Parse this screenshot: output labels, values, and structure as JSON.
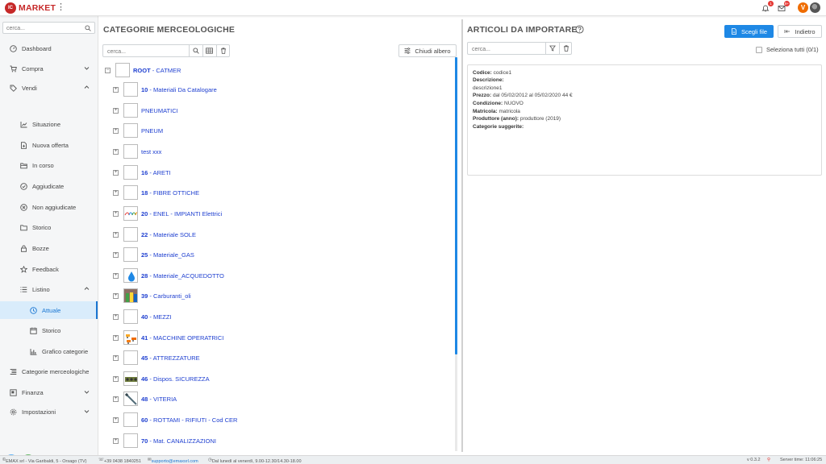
{
  "app": {
    "logo_initials": "IC",
    "logo_text": "MARKET",
    "brand_letter": "V"
  },
  "topbar": {
    "notifications_count": "1",
    "messages_count": "9+"
  },
  "sidebar": {
    "search_placeholder": "cerca...",
    "items": [
      {
        "label": "Dashboard",
        "icon": "dashboard-icon"
      },
      {
        "label": "Compra",
        "icon": "cart-icon",
        "chevron": "down"
      },
      {
        "label": "Vendi",
        "icon": "tag-icon",
        "chevron": "up"
      },
      {
        "label": "Situazione",
        "icon": "chart-line-icon"
      },
      {
        "label": "Nuova offerta",
        "icon": "new-document-icon"
      },
      {
        "label": "In corso",
        "icon": "folder-open-icon"
      },
      {
        "label": "Aggiudicate",
        "icon": "check-circle-icon"
      },
      {
        "label": "Non aggiudicate",
        "icon": "x-circle-icon"
      },
      {
        "label": "Storico",
        "icon": "folder-icon"
      },
      {
        "label": "Bozze",
        "icon": "lock-icon"
      },
      {
        "label": "Feedback",
        "icon": "star-icon"
      },
      {
        "label": "Listino",
        "icon": "list-icon",
        "chevron": "up"
      },
      {
        "label": "Attuale",
        "icon": "clock-icon",
        "active": true
      },
      {
        "label": "Storico",
        "icon": "calendar-icon"
      },
      {
        "label": "Grafico categorie",
        "icon": "bar-chart-icon"
      },
      {
        "label": "Categorie merceologiche",
        "icon": "tree-list-icon"
      },
      {
        "label": "Finanza",
        "icon": "finance-icon",
        "chevron": "down"
      },
      {
        "label": "Impostazioni",
        "icon": "gear-icon",
        "chevron": "down"
      }
    ]
  },
  "categories": {
    "title": "CATEGORIE MERCEOLOGICHE",
    "search_placeholder": "cerca...",
    "collapse_label": "Chiudi albero",
    "root": {
      "code": "ROOT",
      "name": "CATMER"
    },
    "rows": [
      {
        "code": "10",
        "name": "Materiali Da Catalogare",
        "thumb": "blank"
      },
      {
        "code": "",
        "name": "PNEUMATICI",
        "thumb": "blank"
      },
      {
        "code": "",
        "name": "PNEUM",
        "thumb": "blank"
      },
      {
        "code": "",
        "name": "test xxx",
        "thumb": "blank"
      },
      {
        "code": "16",
        "name": "ARETI",
        "thumb": "blank"
      },
      {
        "code": "18",
        "name": "FIBRE OTTICHE",
        "thumb": "blank"
      },
      {
        "code": "20",
        "name": "ENEL - IMPIANTI Elettrici",
        "thumb": "enel"
      },
      {
        "code": "22",
        "name": "Materiale SOLE",
        "thumb": "blank"
      },
      {
        "code": "25",
        "name": "Materiale_GAS",
        "thumb": "blank"
      },
      {
        "code": "28",
        "name": "Materiale_ACQUEDOTTO",
        "thumb": "water"
      },
      {
        "code": "39",
        "name": "Carburanti_oli",
        "thumb": "fuel"
      },
      {
        "code": "40",
        "name": "MEZZI",
        "thumb": "blank"
      },
      {
        "code": "41",
        "name": "MACCHINE OPERATRICI",
        "thumb": "machines"
      },
      {
        "code": "45",
        "name": "ATTREZZATURE",
        "thumb": "blank"
      },
      {
        "code": "46",
        "name": "Dispos. SICUREZZA",
        "thumb": "safety"
      },
      {
        "code": "48",
        "name": "VITERIA",
        "thumb": "screw"
      },
      {
        "code": "60",
        "name": "ROTTAMI - RIFIUTI - Cod CER",
        "thumb": "blank"
      },
      {
        "code": "70",
        "name": "Mat. CANALIZZAZIONI",
        "thumb": "blank"
      }
    ]
  },
  "import": {
    "title": "ARTICOLI DA IMPORTARE",
    "choose_file_label": "Scegli file",
    "back_label": "Indietro",
    "search_placeholder": "cerca...",
    "select_all_label": "Seleziona tutti (0/1)",
    "item": {
      "codice_label": "Codice:",
      "codice_value": "codice1",
      "descrizione_label": "Descrizione:",
      "descrizione_value": "descrizione1",
      "prezzo_label": "Prezzo:",
      "prezzo_value": "dal 05/02/2012 al 05/02/2020 44 €",
      "condizione_label": "Condizione:",
      "condizione_value": "NUOVO",
      "matricola_label": "Matricola:",
      "matricola_value": "matricola",
      "produttore_label": "Produttore (anno):",
      "produttore_value": "produttore (2019)",
      "categorie_label": "Categorie suggerite:"
    }
  },
  "statusbar": {
    "company": "EMAX srl - Via Garibaldi, 5 - Orsago (TV)",
    "phone": "+39 0438 1840251",
    "email": "supporto@emaxsrl.com",
    "hours": "Dal lunedì al venerdì, 9.00-12.30/14.30-18.00",
    "version": "v 0.3.2",
    "server_time": "Server time: 11:06:25"
  }
}
